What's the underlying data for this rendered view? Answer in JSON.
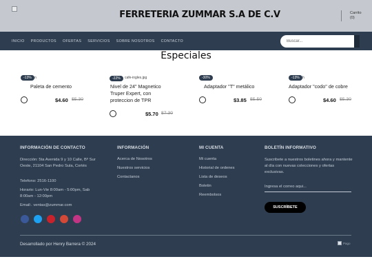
{
  "header": {
    "site_title": "FERRETERIA ZUMMAR S.A DE C.V",
    "cart_label": "Carrito",
    "cart_count": "(0)"
  },
  "nav": {
    "items": [
      "INICIO",
      "PRODUCTOS",
      "OFERTAS",
      "SERVICIOS",
      "SOBRE NOSOTROS",
      "CONTACTO"
    ],
    "search_placeholder": "Buscar..."
  },
  "specials": {
    "title": "Especiales",
    "products": [
      {
        "image_alt": "n",
        "badge": "-13%",
        "name": "Paleta de cemento",
        "price": "$4.60",
        "old_price": "$5.30"
      },
      {
        "image_alt": "cafe-ingles.jpg",
        "badge": "-22%",
        "name": "Nivel de 24\" Magnetico Truper Expert, con proteccion de TPR",
        "price": "$5.70",
        "old_price": "$7.30"
      },
      {
        "image_alt": "na",
        "badge": "-30%",
        "name": "Adaptador \"T\" metálico",
        "price": "$3.85",
        "old_price": "$5.50"
      },
      {
        "image_alt": "h",
        "badge": "-13%",
        "name": "Adaptador \"codo\" de cobre",
        "price": "$4.60",
        "old_price": "$5.30"
      }
    ]
  },
  "footer": {
    "contact": {
      "heading": "INFORMACIÓN DE CONTACTO",
      "address": "Dirección: 5ta Avenida 9 y 10 Calle, Bº Sur Oeste, 21104 San Pedro Sula, Cortés",
      "phone": "Telefono: 2516-1100",
      "hours": "Horario: Lun-Vie 8:00am - 5:00pm, Sab 8:00am - 12:00pm",
      "email": "Email:. ventas@zummar.com"
    },
    "info": {
      "heading": "INFORMACIÓN",
      "links": [
        "Acerca de Nosotros",
        "Nuestros servicios",
        "Contactanos"
      ]
    },
    "account": {
      "heading": "MI CUENTA",
      "links": [
        "Mi cuenta",
        "Historial de ordenes",
        "Lista de deseos",
        "Boletin",
        "Reembolsos"
      ]
    },
    "newsletter": {
      "heading": "BOLETÍN INFORMATIVO",
      "text": "Suscribete a nuestros boletines ahora y mantente al día con nuevas colecciones y ofertas exclusivas.",
      "email_placeholder": "Ingresa el correo aqui...",
      "button": "SUSCRÍBETE"
    },
    "social": [
      {
        "icon": "facebook-icon",
        "color": "#3b5998"
      },
      {
        "icon": "twitter-icon",
        "color": "#1da1f2"
      },
      {
        "icon": "pinterest-icon",
        "color": "#c8232c"
      },
      {
        "icon": "google-plus-icon",
        "color": "#d34836"
      },
      {
        "icon": "instagram-icon",
        "color": "#c13584"
      }
    ],
    "credit": "Desarrollado por Henry Barrera © 2024",
    "payment_alt": "Pago"
  }
}
